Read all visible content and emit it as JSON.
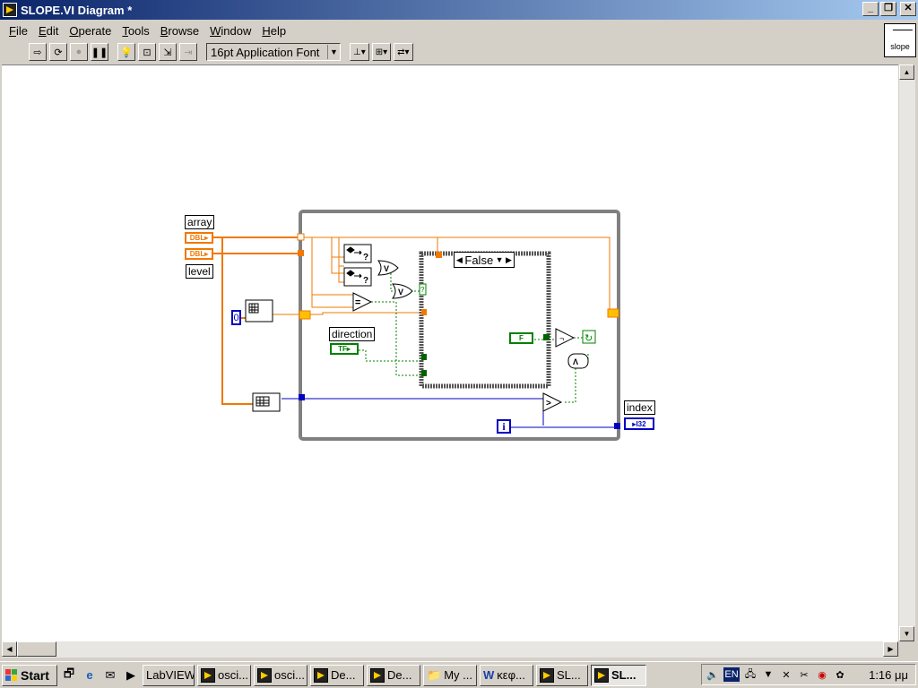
{
  "window": {
    "title": "SLOPE.VI Diagram *"
  },
  "menu": [
    {
      "label": "File",
      "ul": "F",
      "rest": "ile"
    },
    {
      "label": "Edit",
      "ul": "E",
      "rest": "dit"
    },
    {
      "label": "Operate",
      "ul": "O",
      "rest": "perate"
    },
    {
      "label": "Tools",
      "ul": "T",
      "rest": "ools"
    },
    {
      "label": "Browse",
      "ul": "B",
      "rest": "rowse"
    },
    {
      "label": "Window",
      "ul": "W",
      "rest": "indow"
    },
    {
      "label": "Help",
      "ul": "H",
      "rest": "elp"
    }
  ],
  "toolbar": {
    "font": "16pt Application Font"
  },
  "vi_icon": {
    "label": "slope"
  },
  "diagram": {
    "labels": {
      "array": "array",
      "level": "level",
      "direction": "direction",
      "index": "index",
      "case_selector": "False",
      "dbl": "DBL",
      "tf": "TF",
      "false_const": "F",
      "i32": "I32",
      "zero": "0",
      "loop_i": "i"
    },
    "colors": {
      "orange": "#f07800",
      "blue": "#0000c0",
      "green": "#008000",
      "frame": "#808080"
    }
  },
  "taskbar": {
    "start": "Start",
    "tasks": [
      {
        "label": "LabVIEW",
        "icon": "none"
      },
      {
        "label": "osci...",
        "icon": "labview-icon"
      },
      {
        "label": "osci...",
        "icon": "labview-icon"
      },
      {
        "label": "De...",
        "icon": "labview-icon"
      },
      {
        "label": "De...",
        "icon": "labview-icon"
      },
      {
        "label": "My ...",
        "icon": "folder-icon"
      },
      {
        "label": "κεφ...",
        "icon": "word-icon"
      },
      {
        "label": "SL...",
        "icon": "labview-icon"
      },
      {
        "label": "SL...",
        "icon": "labview-icon",
        "active": true
      }
    ],
    "tray": {
      "lang": "EN",
      "clock": "1:16 μμ"
    }
  }
}
